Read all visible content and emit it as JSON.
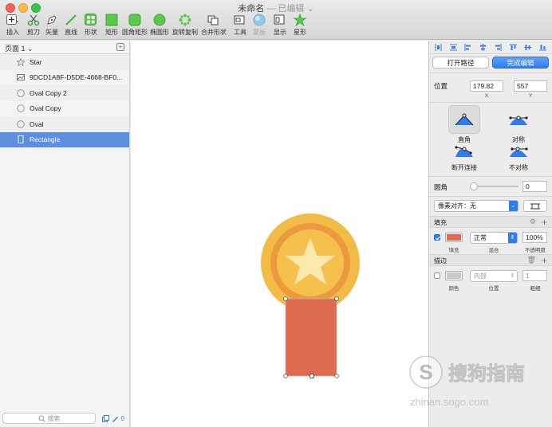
{
  "window": {
    "title": "未命名",
    "title_sub": "— 已编辑 ⌄"
  },
  "toolbar": [
    {
      "label": "插入"
    },
    {
      "label": "剪刀"
    },
    {
      "label": "矢量"
    },
    {
      "label": "直线"
    },
    {
      "label": "形状"
    },
    {
      "label": "矩形"
    },
    {
      "label": "圆角矩形"
    },
    {
      "label": "椭圆形"
    },
    {
      "label": "旋转复制"
    },
    {
      "label": "合并形状"
    },
    {
      "label": "工具"
    },
    {
      "label": "蒙板"
    },
    {
      "label": "显示"
    },
    {
      "label": "星形"
    }
  ],
  "left_panel": {
    "page_label": "页面 1 ⌄",
    "layers": [
      {
        "name": "Star",
        "icon": "star-icon"
      },
      {
        "name": "9DCD1A8F-D5DE-4668-BF0...",
        "icon": "image-icon"
      },
      {
        "name": "Oval Copy 2",
        "icon": "oval-icon"
      },
      {
        "name": "Oval Copy",
        "icon": "oval-icon"
      },
      {
        "name": "Oval",
        "icon": "oval-icon"
      },
      {
        "name": "Rectangle",
        "icon": "rectangle-icon"
      }
    ],
    "search_placeholder": "搜索",
    "footer_count": "0"
  },
  "inspector": {
    "open_path": "打开路径",
    "finish_edit": "完成编辑",
    "position_label": "位置",
    "x_value": "179.82",
    "y_value": "557",
    "x_label": "X",
    "y_label": "Y",
    "point_types": [
      "直角",
      "对称",
      "断开连接",
      "不对称"
    ],
    "corner_label": "圆角",
    "corner_value": "0",
    "pixel_align": "像素对齐：无",
    "fill_title": "填充",
    "fill_color": "#de6a50",
    "blend_mode": "正常",
    "opacity": "100%",
    "fill_sub": "填充",
    "blend_sub": "混合",
    "opacity_sub": "不透明度",
    "border_title": "描边",
    "border_color": "#c8c8c8",
    "border_position": "内部",
    "border_width": "1",
    "border_sub_color": "颜色",
    "border_sub_position": "位置",
    "border_sub_width": "粗细"
  },
  "colors": {
    "accent": "#2f7cf1",
    "selected_row": "#5c8fe0",
    "medal_outer": "#f2bb45",
    "medal_ring": "#eb9b3e",
    "medal_inner": "#f5c04d",
    "star": "#fde8ae",
    "ribbon": "#de6a50"
  },
  "watermark": {
    "text": "搜狗指南",
    "url": "zhinan.sogo.com"
  }
}
